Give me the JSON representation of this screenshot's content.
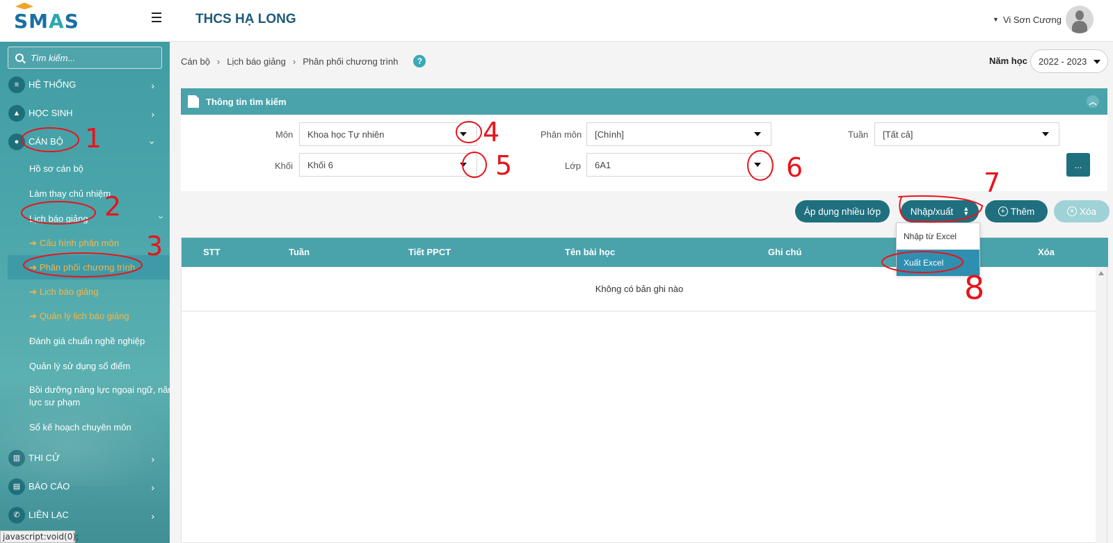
{
  "app": {
    "logo_text_1": "SM",
    "logo_text_2": "A",
    "logo_text_3": "S",
    "school_title": "THCS HẠ LONG",
    "user_name": "Vi Sơn Cương",
    "status_bar": "javascript:void(0);"
  },
  "sidebar": {
    "search_placeholder": "Tìm kiếm...",
    "menus": [
      {
        "label": "HỆ THỐNG",
        "icon": "database-icon"
      },
      {
        "label": "HỌC SINH",
        "icon": "graduation-cap-icon"
      },
      {
        "label": "CÁN BỘ",
        "icon": "users-icon"
      }
    ],
    "canbo_items": [
      "Hồ sơ cán bộ",
      "Làm thay chủ nhiệm",
      "Lịch báo giảng"
    ],
    "lichbaogiang_items": [
      "Cấu hình phân môn",
      "Phân phối chương trình",
      "Lịch báo giảng",
      "Quản lý lịch báo giảng"
    ],
    "canbo_items_more": [
      "Đánh giá chuẩn nghề nghiệp",
      "Quản lý sử dụng sổ điểm",
      "Bồi dưỡng năng lực ngoại ngữ, năng lực sư phạm",
      "Sổ kế hoạch chuyên môn"
    ],
    "bottom_menus": [
      {
        "label": "THI CỬ",
        "icon": "chart-icon"
      },
      {
        "label": "BÁO CÁO",
        "icon": "document-icon"
      },
      {
        "label": "LIÊN LẠC",
        "icon": "phone-icon"
      }
    ]
  },
  "breadcrumb": [
    "Cán bộ",
    "Lịch báo giảng",
    "Phân phối chương trình"
  ],
  "school_year": {
    "label": "Năm học",
    "value": "2022 - 2023"
  },
  "search_panel": {
    "title": "Thông tin tìm kiếm",
    "fields": {
      "mon": {
        "label": "Môn",
        "value": "Khoa học Tự nhiên"
      },
      "phanmon": {
        "label": "Phân môn",
        "value": "[Chính]"
      },
      "tuan": {
        "label": "Tuần",
        "value": "[Tất cả]"
      },
      "khoi": {
        "label": "Khối",
        "value": "Khối 6"
      },
      "lop": {
        "label": "Lớp",
        "value": "6A1"
      }
    },
    "more_button": "..."
  },
  "actions": {
    "apply": "Áp dụng nhiều lớp",
    "import_export": "Nhập/xuất",
    "add": "Thêm",
    "delete": "Xóa"
  },
  "dropdown": {
    "items": [
      "Nhập từ Excel",
      "Xuất Excel"
    ]
  },
  "table": {
    "headers": [
      "STT",
      "Tuần",
      "Tiết PPCT",
      "Tên bài học",
      "Ghi chú",
      "Xóa"
    ],
    "empty_text": "Không có bản ghi nào"
  },
  "annotations": [
    "1",
    "2",
    "3",
    "4",
    "5",
    "6",
    "7",
    "8"
  ],
  "colors": {
    "accent": "#4aa3ab",
    "button": "#1f6f7f",
    "submenu_text": "#f7b44a",
    "annotation": "#e8141c"
  }
}
